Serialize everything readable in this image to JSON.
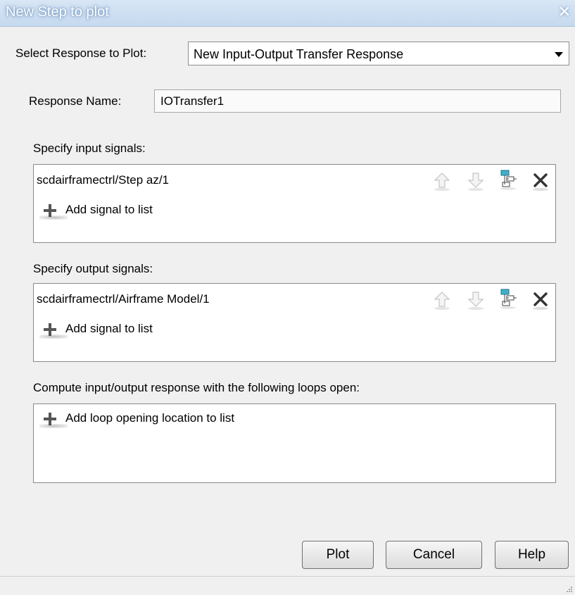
{
  "window": {
    "title": "New Step to plot"
  },
  "response_select": {
    "label": "Select Response to Plot:",
    "selected": "New Input-Output Transfer Response"
  },
  "response_name": {
    "label": "Response Name:",
    "value": "IOTransfer1"
  },
  "input_signals": {
    "label": "Specify input signals:",
    "items": [
      "scdairframectrl/Step az/1"
    ],
    "add_label": "Add signal to list"
  },
  "output_signals": {
    "label": "Specify output signals:",
    "items": [
      "scdairframectrl/Airframe Model/1"
    ],
    "add_label": "Add signal to list"
  },
  "loops": {
    "label": "Compute input/output response with the following loops open:",
    "add_label": "Add loop opening location to list"
  },
  "icons": {
    "move_up": "arrow-up-icon",
    "move_down": "arrow-down-icon",
    "highlight": "highlight-in-model-icon",
    "delete": "delete-x-icon",
    "add": "plus-icon",
    "close": "close-icon"
  },
  "buttons": {
    "plot": "Plot",
    "cancel": "Cancel",
    "help": "Help"
  },
  "colors": {
    "titlebar": "#c5d9ee",
    "background": "#f0f0f0",
    "highlight_icon": "#3fb2c9"
  }
}
